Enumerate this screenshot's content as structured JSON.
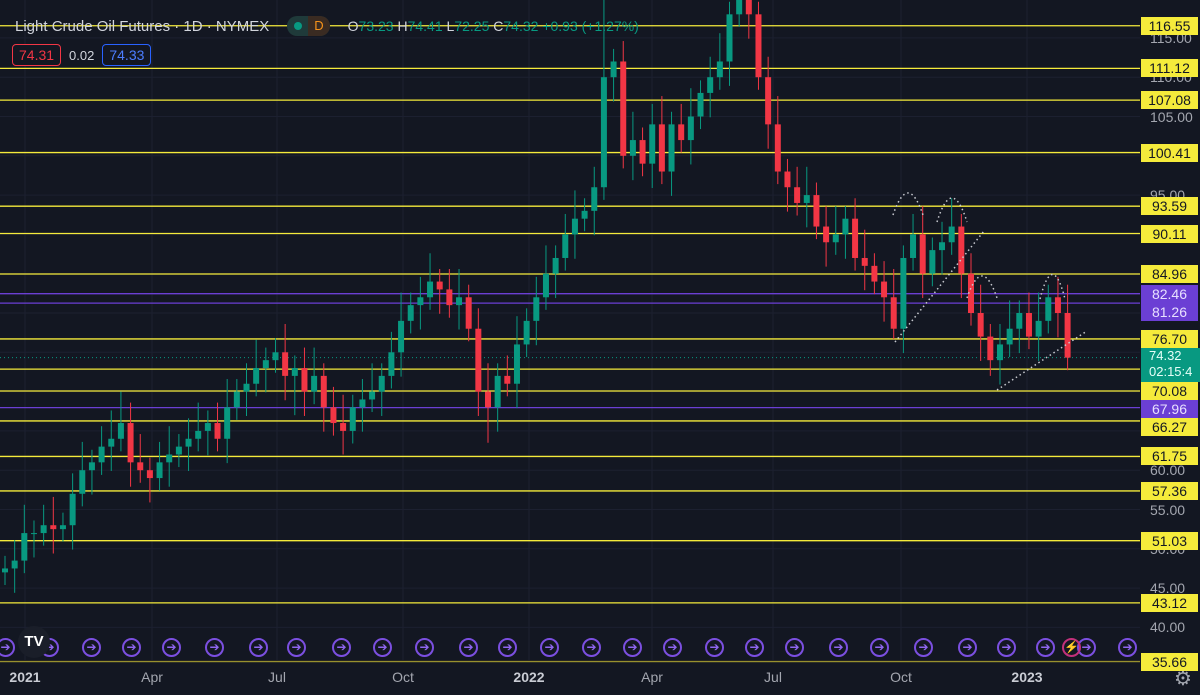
{
  "header": {
    "title": "Light Crude Oil Futures · 1D · NYMEX",
    "market_status": "D",
    "ohlc": {
      "o_label": "O",
      "o": "73.23",
      "h_label": "H",
      "h": "74.41",
      "l_label": "L",
      "l": "72.25",
      "c_label": "C",
      "c": "74.32",
      "change": "+0.93 (+1.27%)"
    }
  },
  "quotes": {
    "bid": "74.31",
    "spread": "0.02",
    "ask": "74.33"
  },
  "current_price": {
    "price": "74.32",
    "countdown": "02:15:4",
    "color": "#089981"
  },
  "colors": {
    "background": "#131722",
    "up": "#089981",
    "down": "#f23645",
    "level_yellow": "#f5eb3b",
    "level_purple": "#6b3fd4",
    "event": "#7b4fe0"
  },
  "levels": [
    {
      "price": 116.55,
      "label": "116.55",
      "color": "yellow"
    },
    {
      "price": 111.12,
      "label": "111.12",
      "color": "yellow"
    },
    {
      "price": 107.08,
      "label": "107.08",
      "color": "yellow"
    },
    {
      "price": 100.41,
      "label": "100.41",
      "color": "yellow"
    },
    {
      "price": 93.59,
      "label": "93.59",
      "color": "yellow"
    },
    {
      "price": 90.11,
      "label": "90.11",
      "color": "yellow"
    },
    {
      "price": 84.96,
      "label": "84.96",
      "color": "yellow"
    },
    {
      "price": 82.46,
      "label": "82.46",
      "color": "purple"
    },
    {
      "price": 81.26,
      "label": "81.26",
      "color": "purple"
    },
    {
      "price": 76.7,
      "label": "76.70",
      "color": "yellow"
    },
    {
      "price": 72.86,
      "label": "72.86",
      "color": "yellow"
    },
    {
      "price": 70.08,
      "label": "70.08",
      "color": "yellow"
    },
    {
      "price": 67.96,
      "label": "67.96",
      "color": "purple"
    },
    {
      "price": 66.27,
      "label": "66.27",
      "color": "yellow"
    },
    {
      "price": 61.75,
      "label": "61.75",
      "color": "yellow"
    },
    {
      "price": 57.36,
      "label": "57.36",
      "color": "yellow"
    },
    {
      "price": 51.03,
      "label": "51.03",
      "color": "yellow"
    },
    {
      "price": 43.12,
      "label": "43.12",
      "color": "yellow"
    },
    {
      "price": 35.66,
      "label": "35.66",
      "color": "yellow"
    }
  ],
  "chart_data": {
    "type": "candlestick",
    "y_axis": {
      "ticks": [
        "115.00",
        "110.00",
        "105.00",
        "95.00",
        "80.00",
        "60.00",
        "55.00",
        "50.00",
        "45.00",
        "40.00"
      ],
      "scale": "linear"
    },
    "x_axis": {
      "ticks": [
        {
          "label": "2021",
          "bold": true
        },
        {
          "label": "Apr"
        },
        {
          "label": "Jul"
        },
        {
          "label": "Oct"
        },
        {
          "label": "2022",
          "bold": true
        },
        {
          "label": "Apr"
        },
        {
          "label": "Jul"
        },
        {
          "label": "Oct"
        },
        {
          "label": "2023",
          "bold": true
        }
      ]
    },
    "interval": "weekly approximation",
    "close": [
      47.5,
      48.5,
      52,
      52,
      53,
      52.5,
      53,
      57,
      60,
      61,
      63,
      64,
      66,
      61,
      60,
      59,
      61,
      62,
      63,
      64,
      65,
      66,
      64,
      68,
      70,
      71,
      73,
      74,
      75,
      72,
      73,
      70,
      72,
      68,
      66,
      65,
      68,
      69,
      70,
      72,
      75,
      79,
      81,
      82,
      84,
      83,
      81,
      82,
      78,
      70,
      68,
      72,
      71,
      76,
      79,
      82,
      85,
      87,
      90,
      92,
      93,
      96,
      110,
      112,
      100,
      102,
      99,
      104,
      98,
      104,
      102,
      105,
      108,
      110,
      112,
      118,
      120,
      118,
      110,
      104,
      98,
      96,
      94,
      95,
      91,
      89,
      90,
      92,
      87,
      86,
      84,
      82,
      78,
      87,
      90,
      85,
      88,
      89,
      91,
      85,
      80,
      77,
      74,
      76,
      78,
      80,
      77,
      79,
      82,
      80,
      74.32
    ],
    "grid": true
  },
  "events": {
    "count_regular": 29,
    "lightning": 1
  },
  "logo": "TV"
}
